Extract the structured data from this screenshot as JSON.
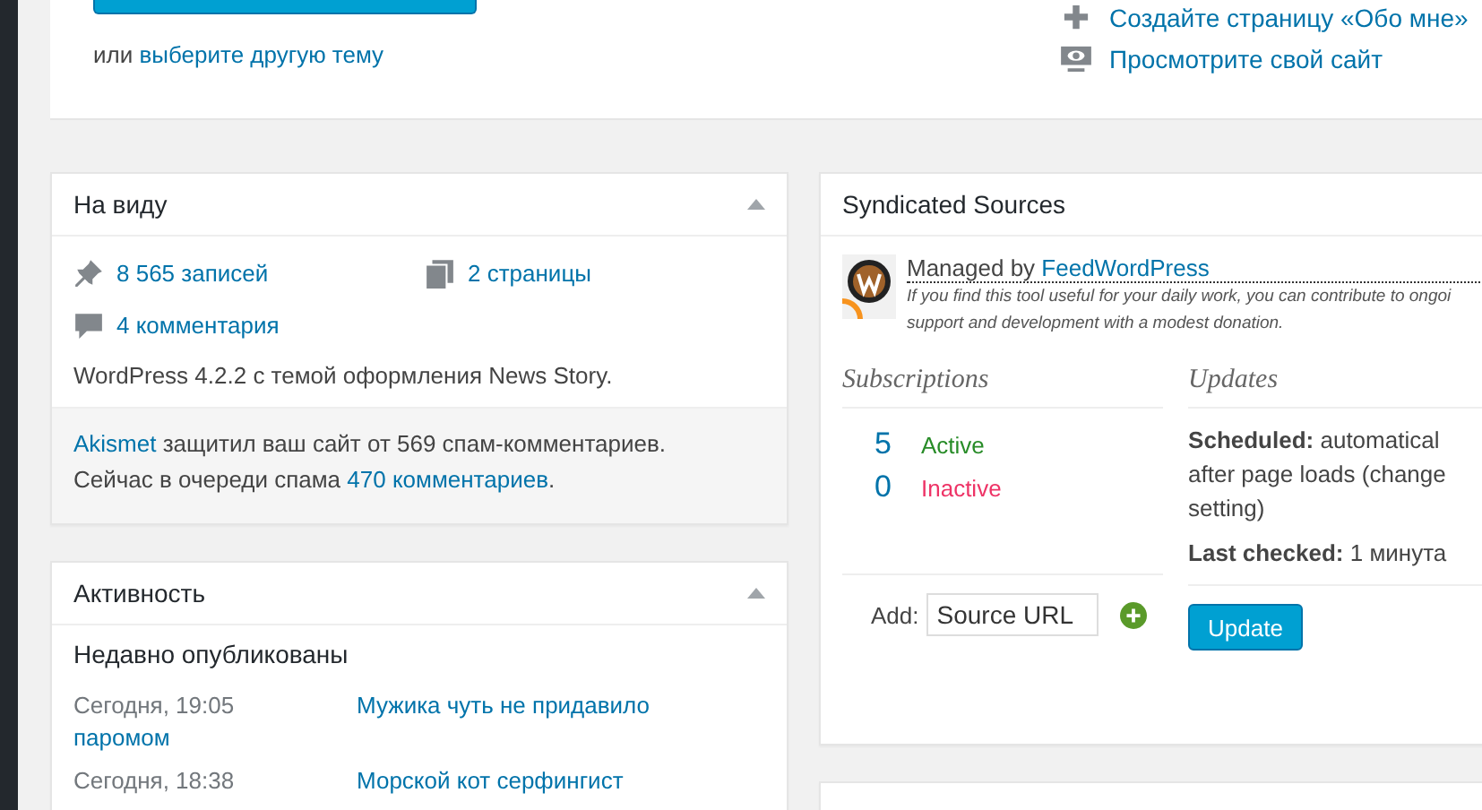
{
  "welcome": {
    "choose_prefix": "или",
    "choose_link": "выберите другую тему",
    "actions": [
      {
        "kind": "plus",
        "label": "Создайте страницу «Обо мне»"
      },
      {
        "kind": "view",
        "label": "Просмотрите свой сайт"
      }
    ]
  },
  "glance": {
    "title": "На виду",
    "stats": [
      {
        "kind": "pin",
        "label": "8 565 записей"
      },
      {
        "kind": "pages",
        "label": "2 страницы"
      },
      {
        "kind": "comment",
        "label": "4 комментария"
      }
    ],
    "version": "WordPress 4.2.2 с темой оформления News Story.",
    "akismet_link": "Akismet",
    "akismet_text": "защитил ваш сайт от 569 спам-комментариев.",
    "queue_prefix": "Сейчас в очереди спама",
    "queue_link": "470 комментариев",
    "queue_suffix": "."
  },
  "activity": {
    "title": "Активность",
    "heading": "Недавно опубликованы",
    "posts": [
      {
        "date": "Сегодня, 19:05",
        "title": [
          "Мужика чуть не придавило",
          "паромом"
        ]
      },
      {
        "date": "Сегодня, 18:38",
        "title": [
          "Морской кот серфингист"
        ]
      }
    ]
  },
  "syndicated": {
    "title": "Syndicated Sources",
    "managed_prefix": "Managed by",
    "managed_link": "FeedWordPress",
    "note": [
      "If you find this tool useful for your daily work, you can contribute to ongoi",
      "support and development with a modest donation."
    ],
    "subs_title": "Subscriptions",
    "updates_title": "Updates",
    "counts": [
      {
        "count": "5",
        "label": "Active",
        "color": "#288c28"
      },
      {
        "count": "0",
        "label": "Inactive",
        "color": "#ee3366"
      }
    ],
    "scheduled": [
      "**Scheduled:** automatical",
      "after page loads (change",
      "setting)"
    ],
    "last_checked": "**Last checked:** 1 минута",
    "add_label": "Add:",
    "add_placeholder": "Source URL",
    "update_button": "Update"
  }
}
